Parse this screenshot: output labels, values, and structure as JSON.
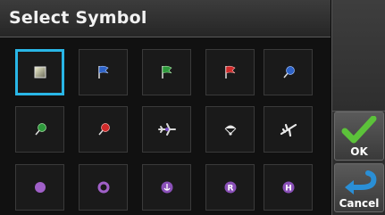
{
  "title": "Select Symbol",
  "symbols": [
    [
      {
        "icon": "square-marker-icon",
        "selected": true
      },
      {
        "icon": "blue-flag-icon"
      },
      {
        "icon": "green-flag-icon"
      },
      {
        "icon": "red-flag-icon"
      },
      {
        "icon": "blue-pin-icon"
      }
    ],
    [
      {
        "icon": "green-pin-icon"
      },
      {
        "icon": "red-pin-icon"
      },
      {
        "icon": "airplane-icon"
      },
      {
        "icon": "parachute-icon"
      },
      {
        "icon": "crashed-airplane-icon"
      }
    ],
    [
      {
        "icon": "purple-dot-icon"
      },
      {
        "icon": "purple-ring-icon"
      },
      {
        "icon": "anchor-circle-icon"
      },
      {
        "icon": "r-circle-icon"
      },
      {
        "icon": "h-circle-icon"
      }
    ]
  ],
  "buttons": {
    "ok_label": "OK",
    "cancel_label": "Cancel"
  },
  "colors": {
    "selection": "#29b6e6",
    "ok_check": "#5cc23a",
    "cancel_arrow": "#2a8fd6"
  }
}
